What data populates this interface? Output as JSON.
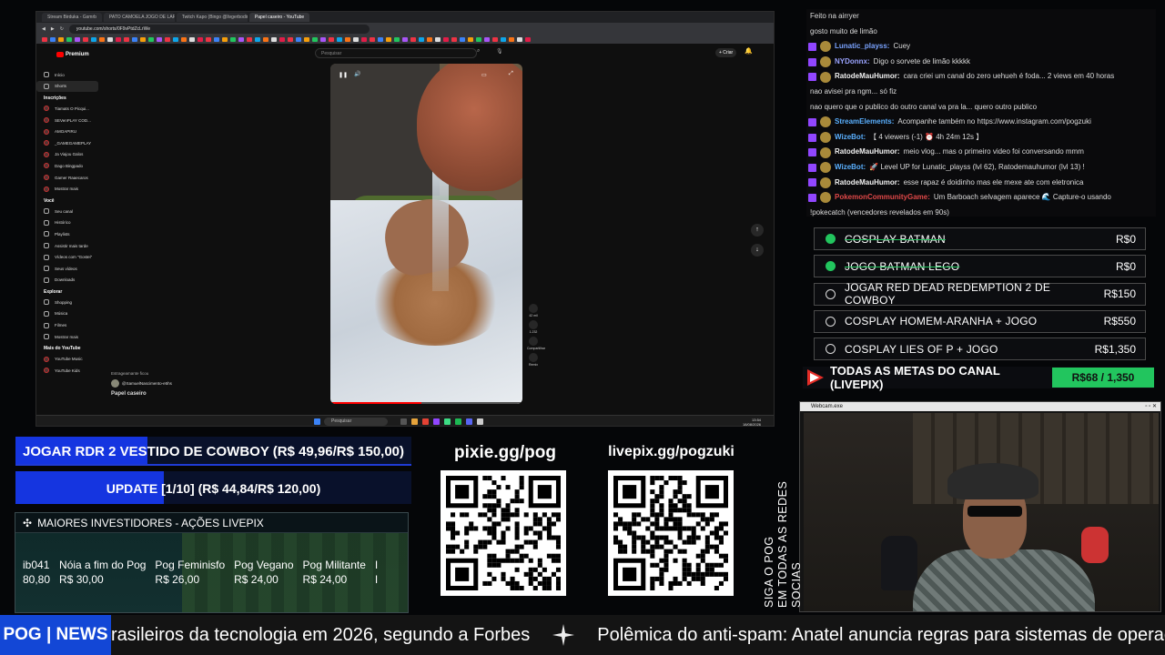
{
  "browser": {
    "tabs": [
      "Stream Birduka - Gsmrb",
      "PATO CAMOELA JOGO DE LAPIAMEN",
      "Twitch Kapo (Bingo @livgerbodingo)",
      "Papel caseiro - YouTube"
    ],
    "address": "youtube.com/shorts/0F9vPtdZcLrWe",
    "search_placeholder": "Pesquisar",
    "logo": "Premium",
    "create_label": "+ Criar"
  },
  "yt_sidebar": {
    "main": [
      "Início",
      "Shorts"
    ],
    "subs_heading": "Inscrições",
    "subs": [
      "Tiamats O Picqui...",
      "SEVenPLAY COD...",
      "AMOAPIRU",
      "_GAMEGAMEPLAY",
      "Ja Viajou Galos",
      "Dago Bingpado",
      "Gamer Raaecaros",
      "Mostrar mais"
    ],
    "you_heading": "Você",
    "you": [
      "Seu canal",
      "Histórico",
      "Playlists",
      "Assistir mais tarde",
      "Vídeos com \"Gostei\"",
      "Seus vídeos",
      "Downloads"
    ],
    "explore_heading": "Explorar",
    "explore": [
      "Shopping",
      "Música",
      "Filmes",
      "Mostrar mais"
    ],
    "more_heading": "Mais do YouTube",
    "more": [
      "YouTube Music",
      "YouTube Kids"
    ]
  },
  "short": {
    "channel": "@SamuelNascimento-e5hs",
    "title": "Papel caseiro",
    "subscribe_hint": "Estrageamante ficou",
    "likes": "42 mil",
    "comments": "1.232",
    "share": "Compartilhar",
    "remix": "Remix"
  },
  "taskbar": {
    "search": "Pesquisar",
    "time": "13:54",
    "date": "18/08/2026"
  },
  "chat": [
    {
      "user": "",
      "text": "Feito na airryer",
      "user_color": "#dcdcdc"
    },
    {
      "user": "",
      "text": "gosto muito de limão",
      "user_color": "#dcdcdc"
    },
    {
      "user": "Lunatic_playss:",
      "text": "Cuey",
      "user_color": "#7aa3ff"
    },
    {
      "user": "NYDonnx:",
      "text": "Digo o sorvete de limão kkkkk",
      "user_color": "#9aa3ff"
    },
    {
      "user": "RatodeMauHumor:",
      "text": "cara criei um canal do zero uehueh é foda... 2 views em 40 horas",
      "user_color": "#f2f2f2"
    },
    {
      "user": "",
      "text": "nao avisei pra ngm... só fiz",
      "user_color": "#dcdcdc"
    },
    {
      "user": "",
      "text": "nao quero que o publico do outro canal va pra la... quero outro publico",
      "user_color": "#dcdcdc"
    },
    {
      "user": "StreamElements:",
      "text": "Acompanhe também no https://www.instagram.com/pogzuki",
      "user_color": "#5ab0ff"
    },
    {
      "user": "WizeBot:",
      "text": "【 4 viewers (-1) ⏰ 4h 24m 12s 】",
      "user_color": "#5ab0ff"
    },
    {
      "user": "RatodeMauHumor:",
      "text": "meio vlog... mas o primeiro video foi conversando mmm",
      "user_color": "#f2f2f2"
    },
    {
      "user": "WizeBot:",
      "text": "🚀 Level UP for Lunatic_playss (lvl 62), Ratodemauhumor (lvl 13) !",
      "user_color": "#5ab0ff"
    },
    {
      "user": "RatodeMauHumor:",
      "text": "esse rapaz é doidinho mas ele mexe ate com eletronica",
      "user_color": "#f2f2f2"
    },
    {
      "user": "PokemonCommunityGame:",
      "text": "Um Barboach selvagem aparece 🌊 Capture-o usando",
      "user_color": "#e04848"
    },
    {
      "user": "",
      "text": "!pokecatch (vencedores revelados em 90s)",
      "user_color": "#dcdcdc"
    }
  ],
  "goals": [
    {
      "label": "COSPLAY BATMAN",
      "value": "R$0",
      "done": true
    },
    {
      "label": "JOGO BATMAN LEGO",
      "value": "R$0",
      "done": true
    },
    {
      "label": "JOGAR RED DEAD REDEMPTION 2 DE COWBOY",
      "value": "R$150",
      "done": false
    },
    {
      "label": "COSPLAY HOMEM-ARANHA + JOGO",
      "value": "R$550",
      "done": false
    },
    {
      "label": "COSPLAY LIES OF P + JOGO",
      "value": "R$1,350",
      "done": false
    }
  ],
  "livepix_goal": {
    "title": "TODAS AS METAS DO CANAL (LIVEPIX)",
    "amount": "R$68 / 1,350",
    "progress": 0.05
  },
  "webcam": {
    "title": "Webcam.exe"
  },
  "meta_bars": [
    {
      "text": "JOGAR RDR 2 VESTIDO DE COWBOY (R$ 49,96/R$ 150,00)",
      "progress": 0.333
    },
    {
      "text": "UPDATE [1/10] (R$ 44,84/R$ 120,00)",
      "progress": 0.374
    }
  ],
  "investors": {
    "title": "MAIORES INVESTIDORES - AÇÕES LIVEPIX",
    "items": [
      {
        "name": "ib041",
        "value": "80,80"
      },
      {
        "name": "Nóia a fim do Pog",
        "value": "R$ 30,00"
      },
      {
        "name": "Pog Feminisfo",
        "value": "R$ 26,00"
      },
      {
        "name": "Pog Vegano",
        "value": "R$ 24,00"
      },
      {
        "name": "Pog Militante",
        "value": "R$ 24,00"
      },
      {
        "name": "I",
        "value": "I"
      }
    ]
  },
  "qr": {
    "left_label": "pixie.gg/pog",
    "right_label": "livepix.gg/pogzuki"
  },
  "social": {
    "line1": "SIGA O POG",
    "line2": "EM TODAS AS REDES SOCIAS"
  },
  "ticker": {
    "label": "POG | NEWS",
    "items": [
      "rasileiros da tecnologia em 2026, segundo a Forbes",
      "Polêmica do anti-spam: Anatel anuncia regras para sistemas de operador"
    ]
  },
  "colors": {
    "accent_green": "#22c55e",
    "meta_blue": "#1535e0",
    "news_blue": "#1347d6",
    "yt_red": "#ff0000"
  }
}
